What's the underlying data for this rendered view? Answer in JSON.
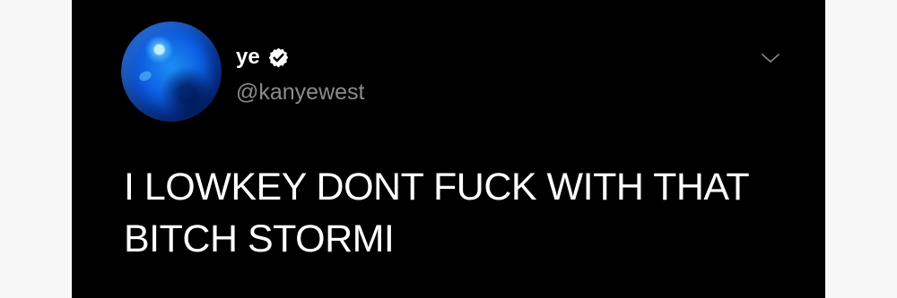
{
  "tweet": {
    "display_name": "ye",
    "handle": "@kanyewest",
    "body_line_1": "I LOWKEY DONT FUCK WITH THAT",
    "body_line_2": "BITCH STORMI",
    "avatar_icon": "blue-sphere-avatar-icon",
    "verified_icon": "verified-badge-icon",
    "menu_icon": "chevron-down-icon"
  },
  "colors": {
    "page_background": "#f7f7f7",
    "card_background": "#000000",
    "primary_text": "#ffffff",
    "secondary_text": "#8b8b8b",
    "icon_gray": "#7f7f7f"
  }
}
